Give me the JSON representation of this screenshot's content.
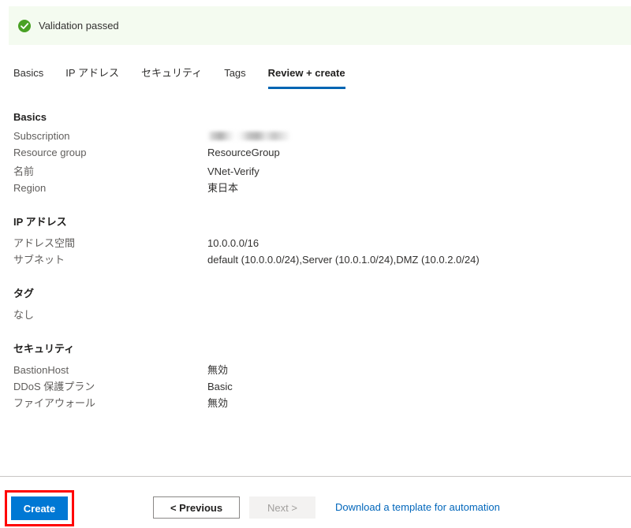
{
  "banner": {
    "icon": "success-check-icon",
    "text": "Validation passed",
    "background": "#f4fbf0",
    "icon_color": "#49a125"
  },
  "tabs": [
    {
      "label": "Basics",
      "selected": false
    },
    {
      "label": "IP アドレス",
      "selected": false
    },
    {
      "label": "セキュリティ",
      "selected": false
    },
    {
      "label": "Tags",
      "selected": false
    },
    {
      "label": "Review + create",
      "selected": true
    }
  ],
  "accent_color": "#0065b3",
  "sections": [
    {
      "title": "Basics",
      "rows": [
        {
          "label": "Subscription",
          "value": "",
          "redacted": true
        },
        {
          "label": "Resource group",
          "value": "ResourceGroup",
          "redacted": false
        },
        {
          "label": "名前",
          "value": "VNet-Verify",
          "redacted": false
        },
        {
          "label": "Region",
          "value": "東日本",
          "redacted": false
        }
      ]
    },
    {
      "title": "IP アドレス",
      "rows": [
        {
          "label": "アドレス空間",
          "value": "10.0.0.0/16",
          "redacted": false
        },
        {
          "label": "サブネット",
          "value": "default (10.0.0.0/24),Server (10.0.1.0/24),DMZ (10.0.2.0/24)",
          "redacted": false
        }
      ]
    },
    {
      "title": "タグ",
      "rows": [
        {
          "label": "なし",
          "value": "",
          "redacted": false
        }
      ]
    },
    {
      "title": "セキュリティ",
      "rows": [
        {
          "label": "BastionHost",
          "value": "無効",
          "redacted": false
        },
        {
          "label": "DDoS 保護プラン",
          "value": "Basic",
          "redacted": false
        },
        {
          "label": "ファイアウォール",
          "value": "無効",
          "redacted": false
        }
      ]
    }
  ],
  "footer": {
    "create_label": "Create",
    "previous_label": "< Previous",
    "next_label": "Next >",
    "next_disabled": true,
    "download_link_label": "Download a template for automation",
    "link_color": "#0066bb",
    "create_color": "#0078d4",
    "annotation_color": "#ff0000"
  }
}
